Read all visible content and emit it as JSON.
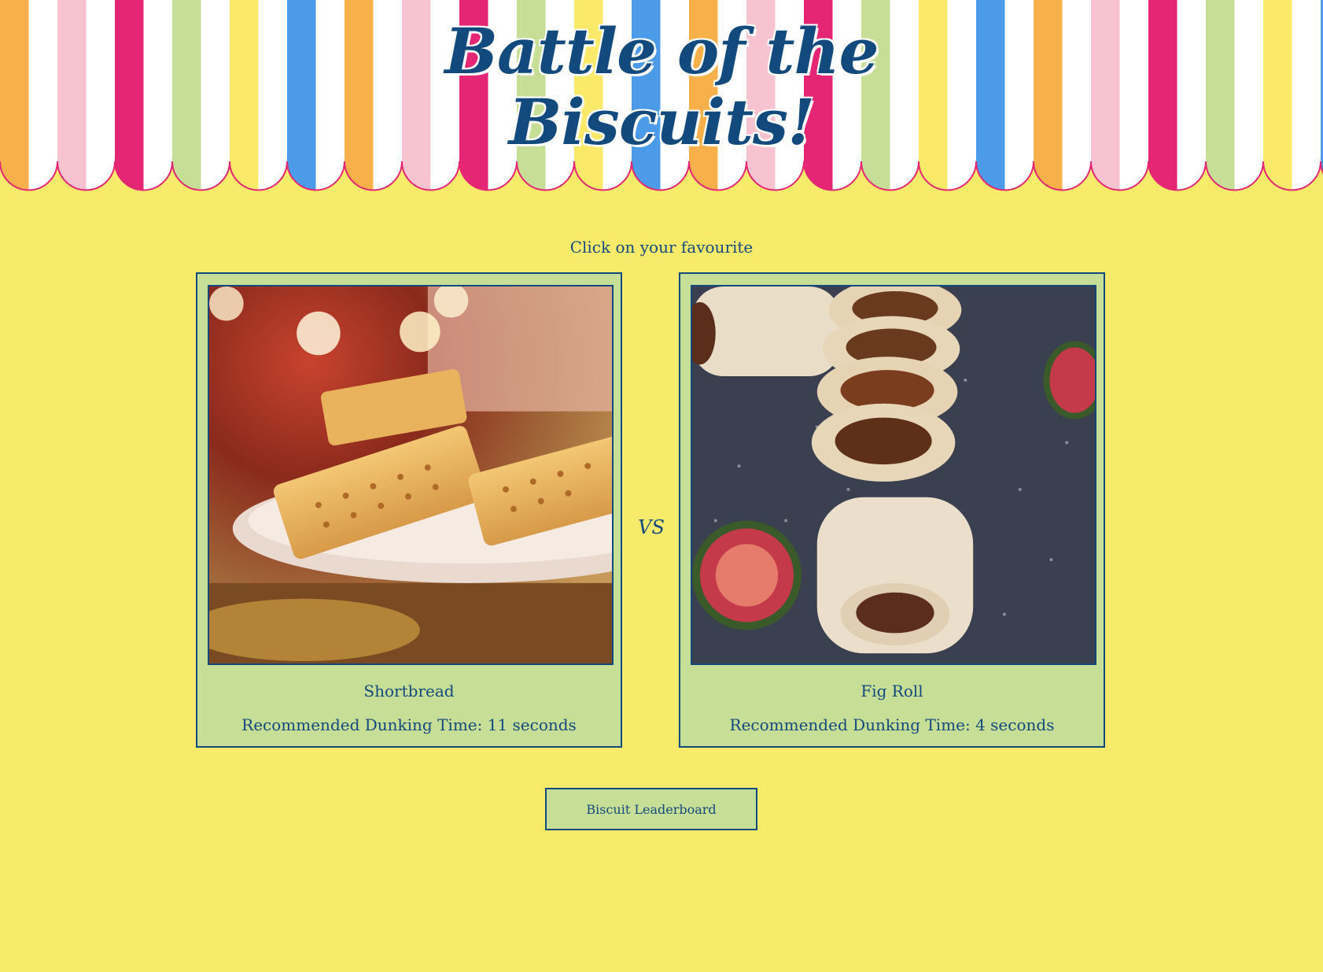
{
  "header": {
    "title_line1": "Battle of the",
    "title_line2": "Biscuits!"
  },
  "colors": {
    "background": "#f8ea6a",
    "card": "#c7de96",
    "text": "#124a7e",
    "stripes": [
      "#f8b04b",
      "#f7c3d1",
      "#e52675",
      "#c7de96",
      "#fbe96a",
      "#4b9be8"
    ]
  },
  "prompt": "Click on your favourite",
  "vs_label": "VS",
  "biscuits": [
    {
      "name": "Shortbread",
      "dunk": "Recommended Dunking Time: 11 seconds",
      "image": "shortbread-photo"
    },
    {
      "name": "Fig Roll",
      "dunk": "Recommended Dunking Time: 4 seconds",
      "image": "fig-roll-photo"
    }
  ],
  "leaderboard_button": "Biscuit Leaderboard"
}
